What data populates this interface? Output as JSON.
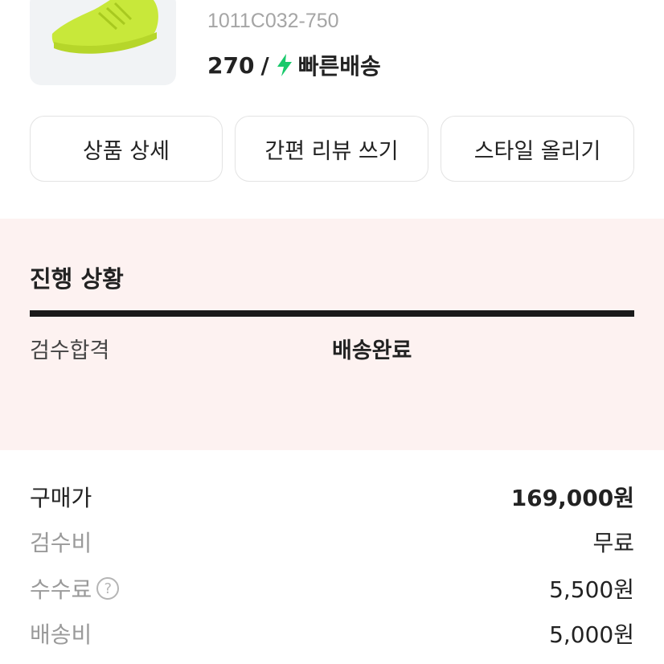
{
  "product": {
    "name_partial": "- ···· ···· -· ·  ·· ·· ··",
    "code": "1011C032-750",
    "size": "270",
    "slash": "/",
    "shipping": "빠른배송",
    "shoe_color": "#c8e83a",
    "bolt_color": "#18c96b"
  },
  "actions": {
    "detail": "상품 상세",
    "review": "간편 리뷰 쓰기",
    "style": "스타일 올리기"
  },
  "progress": {
    "title": "진행 상황",
    "step_inspection": "검수합격",
    "step_delivery": "배송완료",
    "bg_color": "#fdf2f1"
  },
  "fees": {
    "purchase_label": "구매가",
    "purchase_value": "169,000원",
    "inspection_label": "검수비",
    "inspection_value": "무료",
    "commission_label": "수수료",
    "commission_help": "?",
    "commission_value": "5,500원",
    "shipping_label": "배송비",
    "shipping_value": "5,000원"
  }
}
